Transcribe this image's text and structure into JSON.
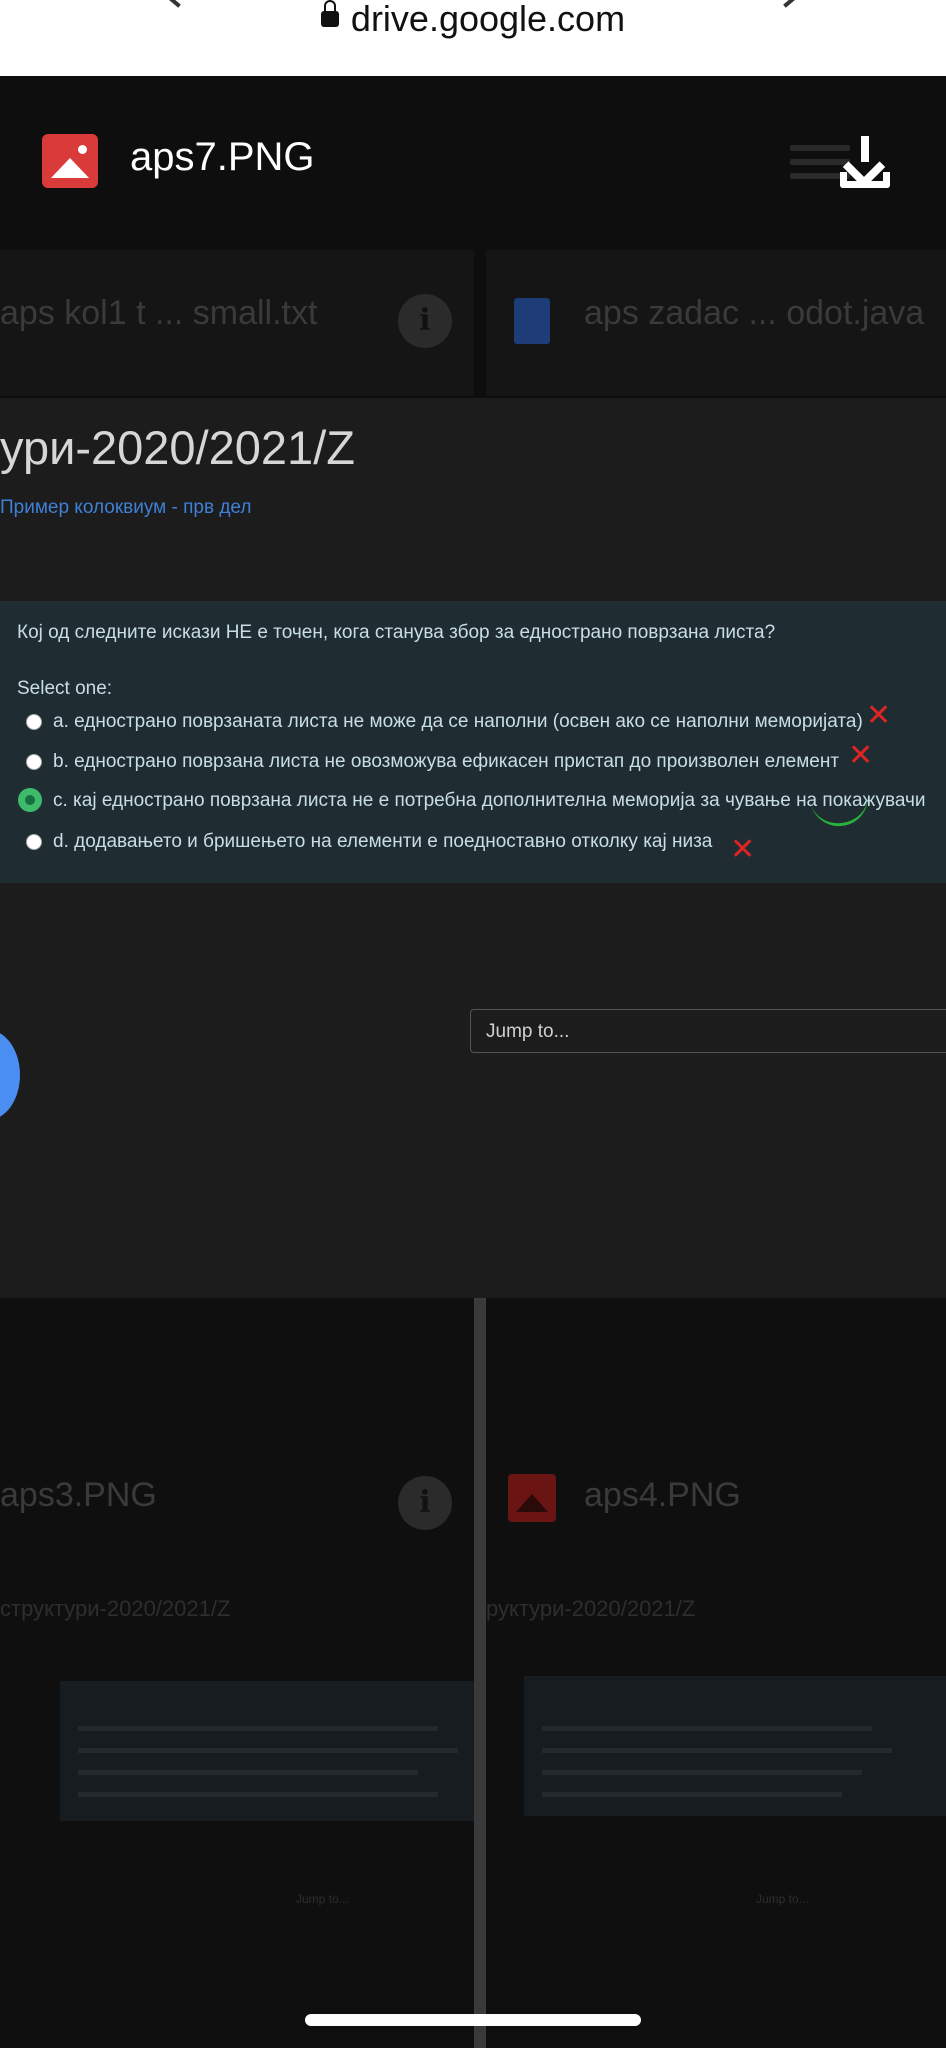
{
  "browser": {
    "url": "drive.google.com"
  },
  "viewer": {
    "file_name": "aps7.PNG",
    "top_cards": [
      {
        "title": "aps kol1 t ... small.txt"
      },
      {
        "title": "aps zadac ... odot.java"
      }
    ],
    "bottom_cards": [
      {
        "title": "aps3.PNG"
      },
      {
        "title": "aps4.PNG"
      }
    ],
    "thumb_titles": [
      "структури-2020/2021/Z",
      "руктури-2020/2021/Z"
    ],
    "thumb_jump": "Jump to..."
  },
  "quiz": {
    "course_title": "ури-2020/2021/Z",
    "breadcrumb": "Пример колоквиум - прв дел",
    "question": "Кој од следните искази НЕ е точен, кога станува збор за еднострано поврзана листа?",
    "select_label": "Select one:",
    "options": [
      {
        "text": "a. еднострано поврзаната листа не може да се наполни (освен ако се наполни меморијата)",
        "mark": "✕"
      },
      {
        "text": "b. еднострано поврзана листа не овозможува ефикасен пристап до произволен елемент",
        "mark": "✕"
      },
      {
        "text": "c. кај еднострано поврзана листа не е потребна дополнителна меморија за чување на покажувачи",
        "mark": "check"
      },
      {
        "text": "d. додавањето и бришењето на елементи е поедноставно отколку кај низа",
        "mark": "✕"
      }
    ],
    "selected_option": "c",
    "jump_label": "Jump to..."
  },
  "colors": {
    "accent_red": "#d93b3b",
    "link_blue": "#3f7fd6",
    "panel": "#1f2d33",
    "check_green": "#26b43b"
  }
}
